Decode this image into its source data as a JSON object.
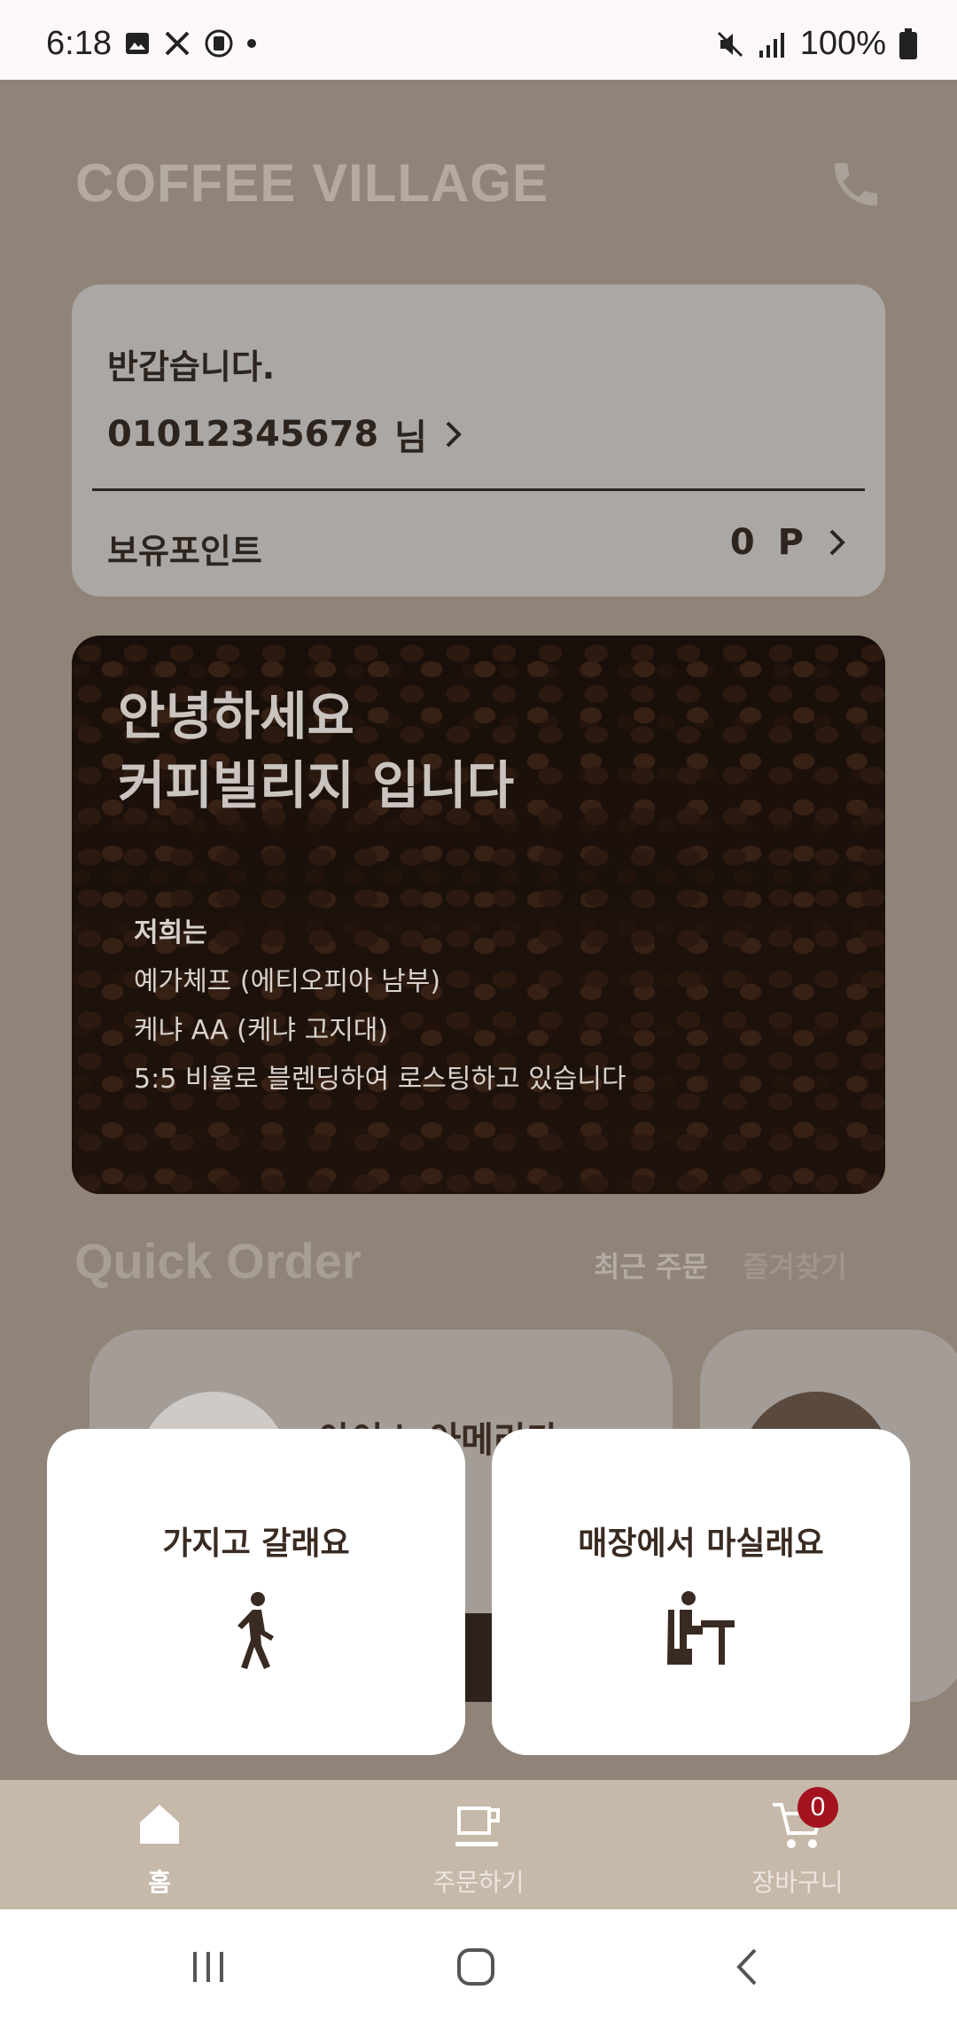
{
  "status_bar": {
    "time": "6:18",
    "battery": "100%"
  },
  "header": {
    "brand": "COFFEE VILLAGE",
    "phone_icon": "phone-icon"
  },
  "member_card": {
    "greeting": "반갑습니다.",
    "user_id": "01012345678",
    "suffix": "님",
    "points_label": "보유포인트",
    "points_value": "0",
    "points_unit": "P"
  },
  "hero": {
    "headline_1": "안녕하세요",
    "headline_2": "커피빌리지 입니다",
    "lead": "저희는",
    "line_1": "예가체프 (에티오피아 남부)",
    "line_2": "케냐 AA (케냐 고지대)",
    "line_3": "5:5 비율로 블렌딩하여 로스팅하고 있습니다"
  },
  "quick_order": {
    "title": "Quick Order",
    "tab_recent": "최근 주문",
    "tab_favorites": "즐겨찾기",
    "card_title_partial": "아이스 아메리카"
  },
  "order_type": {
    "takeout_label": "가지고 갈래요",
    "dine_in_label": "매장에서 마실래요"
  },
  "bottom_nav": {
    "home": "홈",
    "order": "주문하기",
    "cart": "장바구니",
    "cart_count": "0"
  },
  "colors": {
    "brand_dark": "#3a2b22",
    "badge": "#a3121e",
    "nav_bg": "#c6b9aa"
  }
}
